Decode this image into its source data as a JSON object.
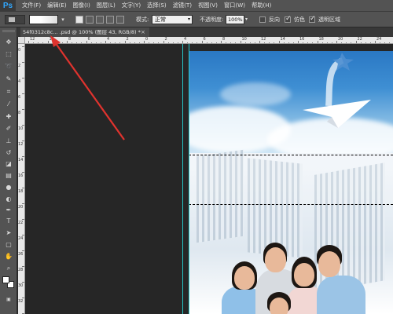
{
  "app": {
    "logo": "Ps"
  },
  "menu": {
    "items": [
      "文件(F)",
      "编辑(E)",
      "图像(I)",
      "图层(L)",
      "文字(Y)",
      "选择(S)",
      "滤镜(T)",
      "视图(V)",
      "窗口(W)",
      "帮助(H)"
    ]
  },
  "options": {
    "mode_label": "模式:",
    "mode_value": "正常",
    "opacity_label": "不透明度:",
    "opacity_value": "100%",
    "reverse_label": "反向",
    "dither_label": "仿色",
    "transparency_label": "透明区域",
    "reverse_checked": false,
    "dither_checked": true,
    "transparency_checked": true,
    "shape_icons": [
      "linear-gradient-icon",
      "radial-gradient-icon",
      "angle-gradient-icon",
      "reflected-gradient-icon",
      "diamond-gradient-icon"
    ]
  },
  "document": {
    "tab_title": "54f0312c8c... .psd @ 100% (图层 43, RGB/8) *",
    "close_symbol": "×"
  },
  "rulers": {
    "horizontal_labels": [
      "12",
      "10",
      "8",
      "6",
      "4",
      "2",
      "0",
      "2",
      "4",
      "6",
      "8",
      "10",
      "12",
      "14",
      "16",
      "18",
      "20",
      "22",
      "24"
    ],
    "vertical_labels": [
      "0",
      "2",
      "4",
      "6",
      "8",
      "10",
      "12",
      "14",
      "16",
      "18",
      "20",
      "22",
      "24",
      "26",
      "28",
      "30",
      "32",
      "34"
    ]
  },
  "tools": [
    "move-tool-icon",
    "marquee-tool-icon",
    "lasso-tool-icon",
    "quick-select-tool-icon",
    "crop-tool-icon",
    "eyedropper-tool-icon",
    "healing-brush-tool-icon",
    "brush-tool-icon",
    "clone-stamp-tool-icon",
    "history-brush-tool-icon",
    "eraser-tool-icon",
    "gradient-tool-icon",
    "blur-tool-icon",
    "dodge-tool-icon",
    "pen-tool-icon",
    "type-tool-icon",
    "path-select-tool-icon",
    "shape-tool-icon",
    "hand-tool-icon",
    "zoom-tool-icon"
  ],
  "colors": {
    "annotation_arrow": "#e0332e",
    "guide": "#27c7c7",
    "foreground": "#ffffff",
    "background": "#ffffff"
  }
}
